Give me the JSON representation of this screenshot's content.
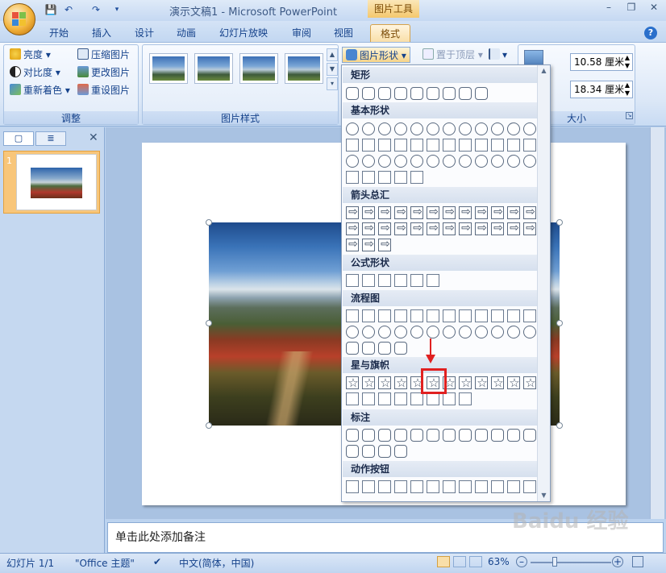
{
  "title_bar": {
    "doc_title": "演示文稿1 - Microsoft PowerPoint",
    "tools_tab": "图片工具",
    "quick_access": [
      "save-icon",
      "undo-icon",
      "redo-icon",
      "dropdown-icon"
    ],
    "window_buttons": [
      "minimize-icon",
      "restore-icon",
      "close-icon"
    ]
  },
  "tabs": [
    "开始",
    "插入",
    "设计",
    "动画",
    "幻灯片放映",
    "审阅",
    "视图",
    "格式"
  ],
  "active_tab": "格式",
  "ribbon": {
    "adjust_group": {
      "label": "调整",
      "buttons": [
        "亮度",
        "对比度",
        "重新着色",
        "压缩图片",
        "更改图片",
        "重设图片"
      ]
    },
    "styles_group": {
      "label": "图片样式"
    },
    "shape_button": "图片形状",
    "arrange_button": "置于顶层",
    "size_group": {
      "label": "大小",
      "height": "10.58 厘米",
      "width": "18.34 厘米"
    }
  },
  "dropdown": {
    "categories": [
      "矩形",
      "基本形状",
      "箭头总汇",
      "公式形状",
      "流程图",
      "星与旗帜",
      "标注",
      "动作按钮"
    ]
  },
  "left_pane": {
    "slide_number": "1"
  },
  "notes_placeholder": "单击此处添加备注",
  "status_bar": {
    "slide_info": "幻灯片 1/1",
    "theme": "\"Office 主题\"",
    "language": "中文(简体，中国)",
    "zoom": "63%"
  },
  "watermark": "Baidu 经验",
  "colors": {
    "accent_tab": "#f9dfa9",
    "highlight": "#e02020",
    "ribbon_text": "#15428b"
  }
}
